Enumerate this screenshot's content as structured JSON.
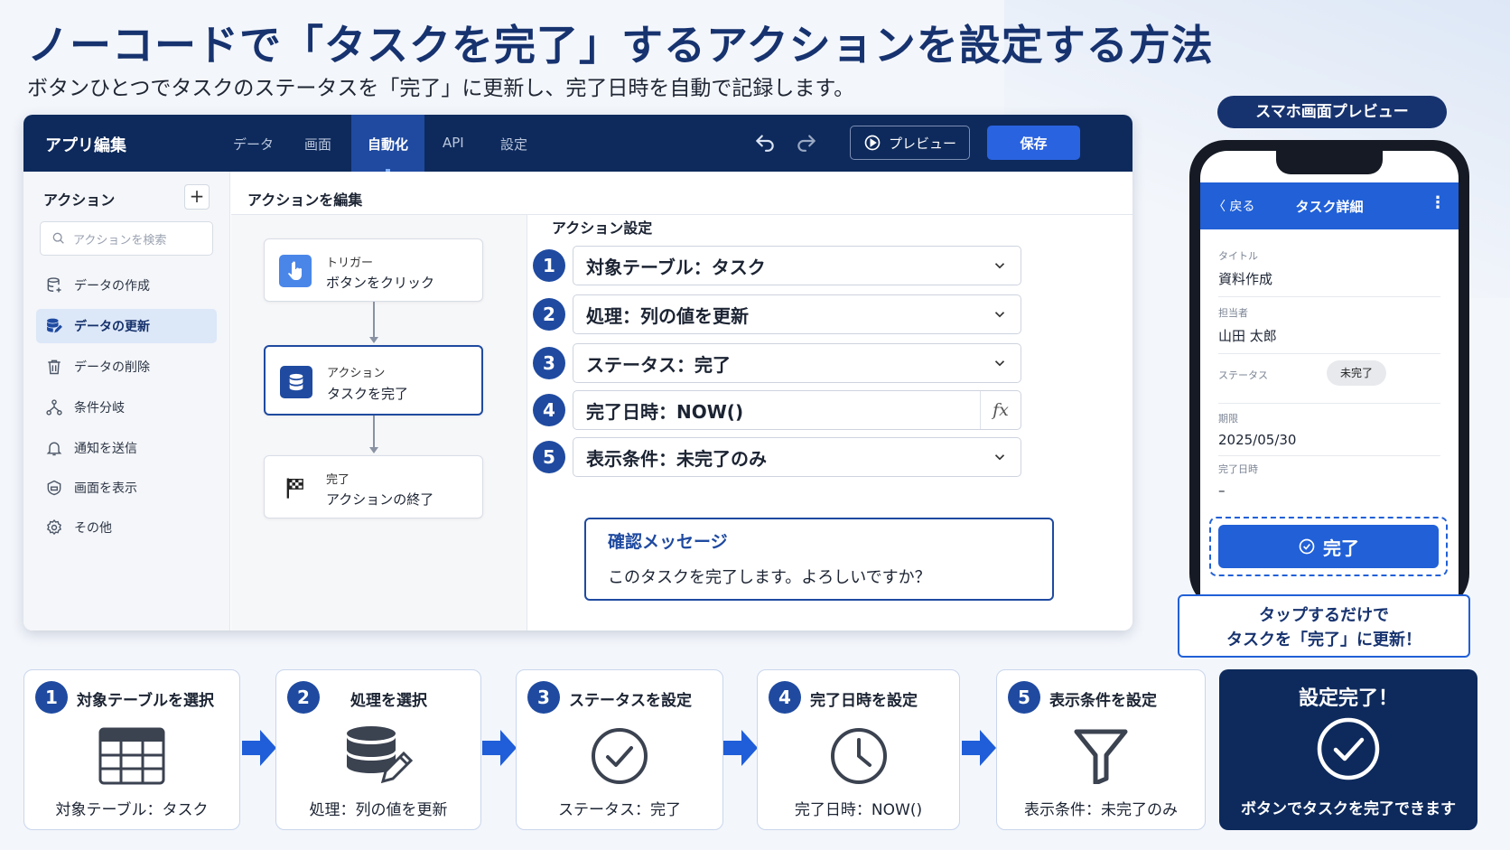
{
  "page": {
    "title": "ノーコードで「タスクを完了」するアクションを設定する方法",
    "subtitle": "ボタンひとつでタスクのステータスを「完了」に更新し、完了日時を自動で記録します。"
  },
  "editor": {
    "app_title": "アプリ編集",
    "tabs": [
      "データ",
      "画面",
      "自動化",
      "API",
      "設定"
    ],
    "active_tab": "自動化",
    "preview_label": "プレビュー",
    "save_label": "保存"
  },
  "sidebar": {
    "heading": "アクション",
    "add_label": "+",
    "search_placeholder": "アクションを検索",
    "items": [
      {
        "label": "データの作成",
        "icon": "database-plus-icon"
      },
      {
        "label": "データの更新",
        "icon": "database-edit-icon",
        "active": true
      },
      {
        "label": "データの削除",
        "icon": "trash-icon"
      },
      {
        "label": "条件分岐",
        "icon": "branch-icon"
      },
      {
        "label": "通知を送信",
        "icon": "bell-icon"
      },
      {
        "label": "画面を表示",
        "icon": "screen-icon"
      },
      {
        "label": "その他",
        "icon": "gear-icon"
      }
    ]
  },
  "pane": {
    "heading": "アクションを編集"
  },
  "flow": {
    "nodes": [
      {
        "kind": "トリガー",
        "label": "ボタンをクリック",
        "icon": "hand-pointer-icon"
      },
      {
        "kind": "アクション",
        "label": "タスクを完了",
        "icon": "database-icon"
      },
      {
        "kind": "完了",
        "label": "アクションの終了",
        "icon": "flag-icon"
      }
    ]
  },
  "settings": {
    "heading": "アクション設定",
    "rows": [
      {
        "num": "1",
        "label": "対象テーブル：タスク"
      },
      {
        "num": "2",
        "label": "処理：列の値を更新"
      },
      {
        "num": "3",
        "label": "ステータス：完了"
      },
      {
        "num": "4",
        "label": "完了日時：NOW()",
        "fx": "fx"
      },
      {
        "num": "5",
        "label": "表示条件：未完了のみ"
      }
    ],
    "confirm_title": "確認メッセージ",
    "confirm_body": "このタスクを完了します。よろしいですか？"
  },
  "phone": {
    "tag": "スマホ画面プレビュー",
    "back": "〈 戻る",
    "title": "タスク詳細",
    "more": "⋮",
    "fields": [
      {
        "label": "タイトル",
        "value": "資料作成"
      },
      {
        "label": "担当者",
        "value": "山田 太郎"
      },
      {
        "label": "ステータス",
        "value": "未完了"
      },
      {
        "label": "期限",
        "value": "2025/05/30"
      },
      {
        "label": "完了日時",
        "value": "–"
      }
    ],
    "complete_button": "完了",
    "callout_line1": "タップするだけで",
    "callout_line2": "タスクを「完了」に更新！"
  },
  "steps": [
    {
      "num": "1",
      "title": "対象テーブルを選択",
      "value": "対象テーブル：タスク",
      "icon": "table-icon"
    },
    {
      "num": "2",
      "title": "処理を選択",
      "value": "処理：列の値を更新",
      "icon": "database-edit-icon"
    },
    {
      "num": "3",
      "title": "ステータスを設定",
      "value": "ステータス：完了",
      "icon": "check-circle-icon"
    },
    {
      "num": "4",
      "title": "完了日時を設定",
      "value": "完了日時：NOW()",
      "icon": "clock-icon"
    },
    {
      "num": "5",
      "title": "表示条件を設定",
      "value": "表示条件：未完了のみ",
      "icon": "filter-icon"
    }
  ],
  "final": {
    "title": "設定完了！",
    "body": "ボタンでタスクを完了できます"
  },
  "colors": {
    "navy": "#0e2a5c",
    "primary": "#1f4aa0",
    "accent": "#2160d7"
  }
}
